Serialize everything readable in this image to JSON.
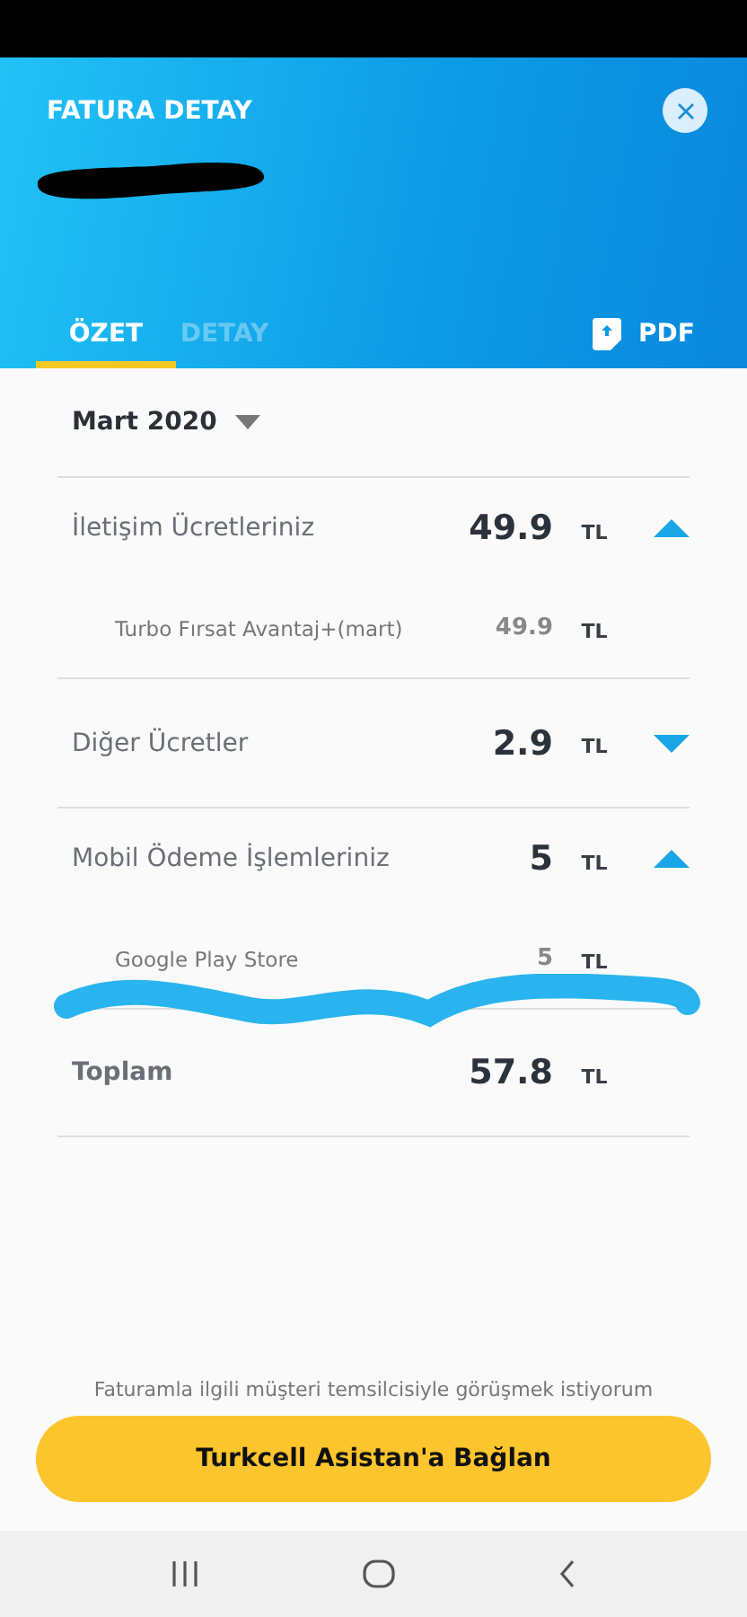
{
  "header": {
    "title": "FATURA DETAY"
  },
  "tabs": [
    {
      "label": "ÖZET",
      "selected": true
    },
    {
      "label": "DETAY",
      "selected": false
    }
  ],
  "pdf_button": {
    "label": "PDF"
  },
  "period": {
    "label": "Mart 2020"
  },
  "sections": [
    {
      "label": "İletişim Ücretleriniz",
      "amount": "49.9",
      "currency": "TL",
      "expanded": true,
      "items": [
        {
          "label": "Turbo Fırsat Avantaj+(mart)",
          "amount": "49.9",
          "currency": "TL"
        }
      ]
    },
    {
      "label": "Diğer Ücretler",
      "amount": "2.9",
      "currency": "TL",
      "expanded": false
    },
    {
      "label": "Mobil Ödeme İşlemleriniz",
      "amount": "5",
      "currency": "TL",
      "expanded": true,
      "items": [
        {
          "label": "Google Play Store",
          "amount": "5",
          "currency": "TL"
        }
      ]
    }
  ],
  "total": {
    "label": "Toplam",
    "amount": "57.8",
    "currency": "TL"
  },
  "footer": {
    "note": "Faturamla ilgili müşteri temsilcisiyle görüşmek istiyorum",
    "button": "Turkcell Asistan'a Bağlan"
  }
}
